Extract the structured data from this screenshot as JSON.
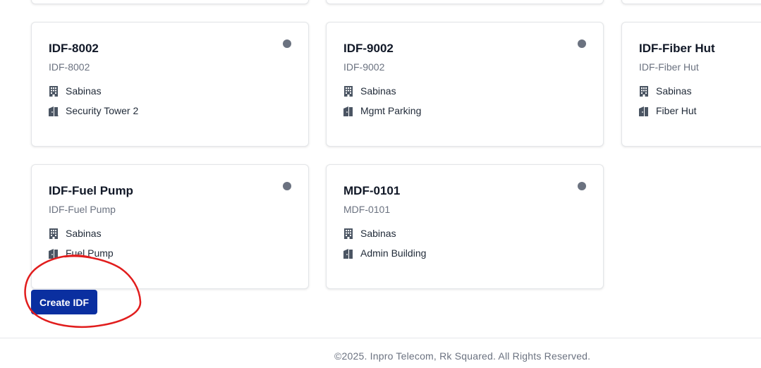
{
  "cards": [
    {
      "title": "IDF-8002",
      "subtitle": "IDF-8002",
      "site": "Sabinas",
      "location": "Security Tower 2",
      "status_color": "#6b7280"
    },
    {
      "title": "IDF-9002",
      "subtitle": "IDF-9002",
      "site": "Sabinas",
      "location": "Mgmt Parking",
      "status_color": "#6b7280"
    },
    {
      "title": "IDF-Fiber Hut",
      "subtitle": "IDF-Fiber Hut",
      "site": "Sabinas",
      "location": "Fiber Hut",
      "status_color": "#6b7280"
    },
    {
      "title": "IDF-Fuel Pump",
      "subtitle": "IDF-Fuel Pump",
      "site": "Sabinas",
      "location": "Fuel Pump",
      "status_color": "#6b7280"
    },
    {
      "title": "MDF-0101",
      "subtitle": "MDF-0101",
      "site": "Sabinas",
      "location": "Admin Building",
      "status_color": "#6b7280"
    }
  ],
  "actions": {
    "create_label": "Create IDF"
  },
  "footer": {
    "copyright": "©2025. Inpro Telecom, Rk Squared. All Rights Reserved."
  },
  "icons": {
    "site_icon": "building-icon",
    "location_icon": "door-icon"
  },
  "colors": {
    "primary": "#0a2fa0",
    "annotation": "#e11d1d",
    "status_inactive": "#6b7280"
  }
}
